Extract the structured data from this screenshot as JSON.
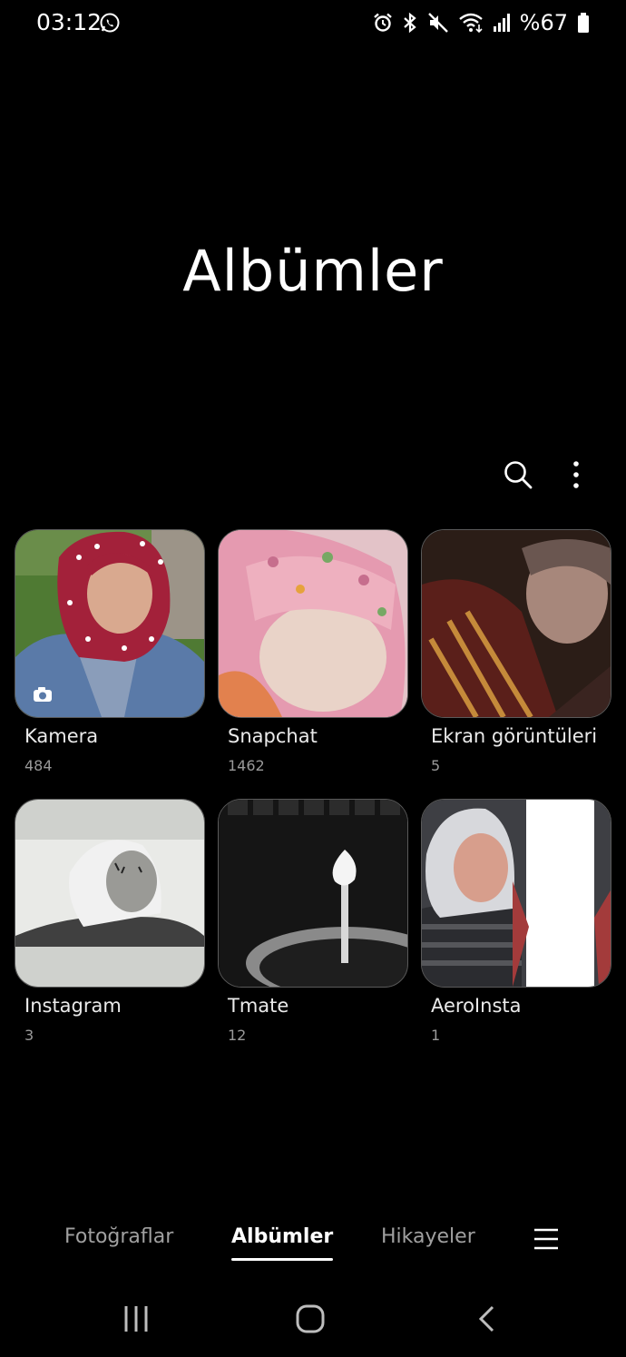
{
  "status_bar": {
    "time": "03:12",
    "battery_percent": "%67",
    "icons": [
      "whatsapp-icon",
      "alarm-icon",
      "bluetooth-icon",
      "mute-icon",
      "wifi-icon",
      "signal-icon",
      "battery-icon"
    ]
  },
  "page": {
    "title": "Albümler"
  },
  "toolbar": {
    "icons": [
      "search-icon",
      "more-options-icon"
    ]
  },
  "albums": [
    {
      "name": "Kamera",
      "count": "484"
    },
    {
      "name": "Snapchat",
      "count": "1462"
    },
    {
      "name": "Ekran görüntüleri",
      "count": "5"
    },
    {
      "name": "Instagram",
      "count": "3"
    },
    {
      "name": "Tmate",
      "count": "12"
    },
    {
      "name": "AeroInsta",
      "count": "1"
    }
  ],
  "bottom_nav": {
    "tabs": [
      {
        "label": "Fotoğraflar",
        "active": false
      },
      {
        "label": "Albümler",
        "active": true
      },
      {
        "label": "Hikayeler",
        "active": false
      }
    ],
    "menu_icon": "hamburger-menu-icon"
  },
  "system_nav": [
    "recent-apps-icon",
    "home-icon",
    "back-icon"
  ],
  "colors": {
    "background": "#000000",
    "text_primary": "#ffffff",
    "text_secondary": "#9a9a9a",
    "tab_inactive": "#a0a0a0"
  }
}
